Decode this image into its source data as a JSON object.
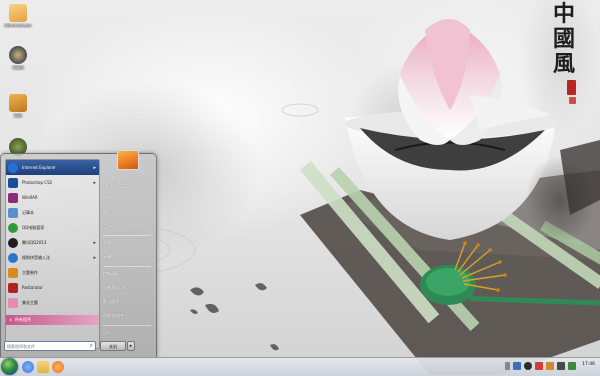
{
  "wallpaper": {
    "calligraphy": [
      "中",
      "國",
      "風"
    ]
  },
  "desktop_icons": [
    {
      "label": "Administrator",
      "icon": "user-folder-icon",
      "color": "#e8a040"
    },
    {
      "label": "计算机",
      "icon": "computer-icon",
      "color": "#5a5a5a"
    },
    {
      "label": "网络",
      "icon": "network-icon",
      "color": "#c07820"
    },
    {
      "label": "",
      "icon": "recycle-bin-icon",
      "color": "#556b2f"
    }
  ],
  "start_menu": {
    "programs": [
      {
        "label": "Internet Explorer",
        "icon": "internet-explorer-icon",
        "color": "#2a6fd6",
        "has_arrow": true,
        "selected": true
      },
      {
        "label": "Photoshop CS2",
        "icon": "photoshop-icon",
        "color": "#1a4f9a",
        "has_arrow": true,
        "selected": false
      },
      {
        "label": "WinRAR",
        "icon": "winrar-icon",
        "color": "#8b2b7a",
        "has_arrow": false,
        "selected": false
      },
      {
        "label": "记事本",
        "icon": "notepad-icon",
        "color": "#5b8fd0",
        "has_arrow": false,
        "selected": false
      },
      {
        "label": "QQ电脑管家",
        "icon": "qq-manager-icon",
        "color": "#2f9a3c",
        "has_arrow": false,
        "selected": false
      },
      {
        "label": "腾讯QQ2013",
        "icon": "qq-icon",
        "color": "#1e1e1e",
        "has_arrow": true,
        "selected": false
      },
      {
        "label": "搜狗拼音输入法",
        "icon": "sogou-icon",
        "color": "#2a79c9",
        "has_arrow": true,
        "selected": false
      },
      {
        "label": "主题制作",
        "icon": "theme-maker-icon",
        "color": "#d98a1e",
        "has_arrow": false,
        "selected": false
      },
      {
        "label": "Restorator",
        "icon": "restorator-icon",
        "color": "#b22222",
        "has_arrow": false,
        "selected": false
      },
      {
        "label": "美化主题",
        "icon": "theme-beautify-icon",
        "color": "#e58ab0",
        "has_arrow": false,
        "selected": false
      }
    ],
    "all_programs_label": "所有程序",
    "search_placeholder": "搜索程序和文件",
    "right_items": [
      {
        "label": "Administrator",
        "offset": 0
      },
      {
        "label": "文档",
        "offset": 1
      },
      {
        "label": "图片",
        "offset": 2
      },
      {
        "label": "音乐",
        "offset": 3
      },
      {
        "label": "游戏",
        "offset": 4
      },
      {
        "label": "计算机",
        "offset": 5
      },
      {
        "label": "控制面板",
        "offset": 6
      },
      {
        "label": "设备和打印机",
        "offset": 7
      },
      {
        "label": "默认程序",
        "offset": 8
      },
      {
        "label": "帮助和支持",
        "offset": 9
      },
      {
        "label": "运行...",
        "offset": 10
      }
    ],
    "shutdown_label": "关机"
  },
  "taskbar": {
    "pinned": [
      {
        "icon": "internet-explorer-icon",
        "color": "#3b7be0"
      },
      {
        "icon": "explorer-folder-icon",
        "color": "#e3b341"
      },
      {
        "icon": "media-player-icon",
        "color": "#e8731e"
      }
    ],
    "tray_icons": [
      {
        "icon": "chevron-up-icon",
        "color": "#555"
      },
      {
        "icon": "network-tray-icon",
        "color": "#3b6fb6"
      },
      {
        "icon": "qq-tray-icon",
        "color": "#2b2b2b"
      },
      {
        "icon": "sogou-tray-icon",
        "color": "#d43a3a"
      },
      {
        "icon": "flag-icon",
        "color": "#cf8c2e"
      },
      {
        "icon": "volume-icon",
        "color": "#4a4a4a"
      },
      {
        "icon": "power-icon",
        "color": "#3a8a3a"
      }
    ],
    "clock": "17:46"
  }
}
